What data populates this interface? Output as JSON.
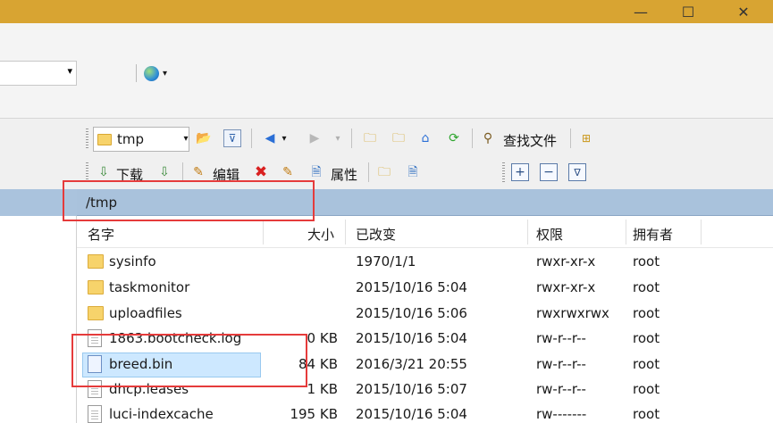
{
  "window": {
    "minimize_glyph": "—",
    "maximize_glyph": "☐",
    "close_glyph": "✕"
  },
  "toolbar1": {
    "path_combo_value": "tmp",
    "find_files_label": "查找文件"
  },
  "toolbar2": {
    "download_label": "下载",
    "edit_label": "编辑",
    "properties_label": "属性"
  },
  "pathbar": {
    "path": "/tmp"
  },
  "filelist": {
    "columns": {
      "name": "名字",
      "size": "大小",
      "modified": "已改变",
      "permissions": "权限",
      "owner": "拥有者"
    },
    "rows": [
      {
        "type": "folder",
        "name": "sysinfo",
        "size": "",
        "modified": "1970/1/1",
        "permissions": "rwxr-xr-x",
        "owner": "root"
      },
      {
        "type": "folder",
        "name": "taskmonitor",
        "size": "",
        "modified": "2015/10/16 5:04",
        "permissions": "rwxr-xr-x",
        "owner": "root"
      },
      {
        "type": "folder",
        "name": "uploadfiles",
        "size": "",
        "modified": "2015/10/16 5:06",
        "permissions": "rwxrwxrwx",
        "owner": "root"
      },
      {
        "type": "file",
        "name": "1863.bootcheck.log",
        "size": "0 KB",
        "modified": "2015/10/16 5:04",
        "permissions": "rw-r--r--",
        "owner": "root"
      },
      {
        "type": "bin",
        "name": "breed.bin",
        "size": "84 KB",
        "modified": "2016/3/21 20:55",
        "permissions": "rw-r--r--",
        "owner": "root",
        "selected": true
      },
      {
        "type": "file",
        "name": "dhcp.leases",
        "size": "1 KB",
        "modified": "2015/10/16 5:07",
        "permissions": "rw-r--r--",
        "owner": "root"
      },
      {
        "type": "file",
        "name": "luci-indexcache",
        "size": "195 KB",
        "modified": "2015/10/16 5:04",
        "permissions": "rw-------",
        "owner": "root"
      }
    ]
  },
  "colors": {
    "titlebar": "#d8a432",
    "pathbar": "#a9c2dc",
    "selection": "#cde8ff",
    "annotation_red": "#e53b3b"
  }
}
